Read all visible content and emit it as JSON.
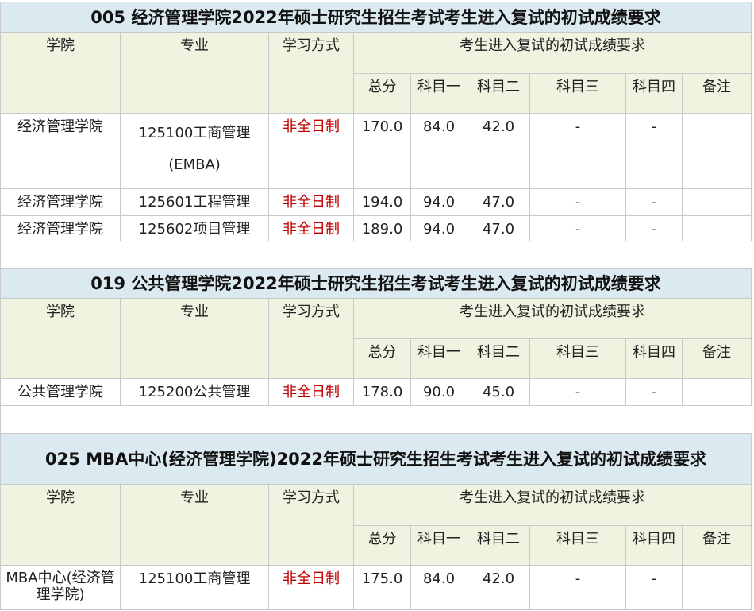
{
  "columns": {
    "college": "学院",
    "major": "专业",
    "mode": "学习方式",
    "requirement": "考生进入复试的初试成绩要求",
    "total": "总分",
    "subject1": "科目一",
    "subject2": "科目二",
    "subject3": "科目三",
    "subject4": "科目四",
    "remark": "备注"
  },
  "sections": [
    {
      "title": "005 经济管理学院2022年硕士研究生招生考试考生进入复试的初试成绩要求",
      "rows": [
        {
          "college": "经济管理学院",
          "major": "125100工商管理",
          "major2": "(EMBA)",
          "mode": "非全日制",
          "total": "170.0",
          "s1": "84.0",
          "s2": "42.0",
          "s3": "-",
          "s4": "-",
          "remark": ""
        },
        {
          "college": "经济管理学院",
          "major": "125601工程管理",
          "mode": "非全日制",
          "total": "194.0",
          "s1": "94.0",
          "s2": "47.0",
          "s3": "-",
          "s4": "-",
          "remark": ""
        },
        {
          "college": "经济管理学院",
          "major": "125602项目管理",
          "mode": "非全日制",
          "total": "189.0",
          "s1": "94.0",
          "s2": "47.0",
          "s3": "-",
          "s4": "-",
          "remark": ""
        }
      ]
    },
    {
      "title": "019 公共管理学院2022年硕士研究生招生考试考生进入复试的初试成绩要求",
      "rows": [
        {
          "college": "公共管理学院",
          "major": "125200公共管理",
          "mode": "非全日制",
          "total": "178.0",
          "s1": "90.0",
          "s2": "45.0",
          "s3": "-",
          "s4": "-",
          "remark": ""
        }
      ]
    },
    {
      "title": "025 MBA中心(经济管理学院)2022年硕士研究生招生考试考生进入复试的初试成绩要求",
      "rows": [
        {
          "college": "MBA中心(经济管理学院)",
          "major": "125100工商管理",
          "mode": "非全日制",
          "total": "175.0",
          "s1": "84.0",
          "s2": "42.0",
          "s3": "-",
          "s4": "-",
          "remark": ""
        }
      ]
    }
  ],
  "colors": {
    "title_bg": "#dbe9f0",
    "header_bg": "#eef4df",
    "mode_text": "#c00000",
    "border": "#c9c9c9"
  }
}
